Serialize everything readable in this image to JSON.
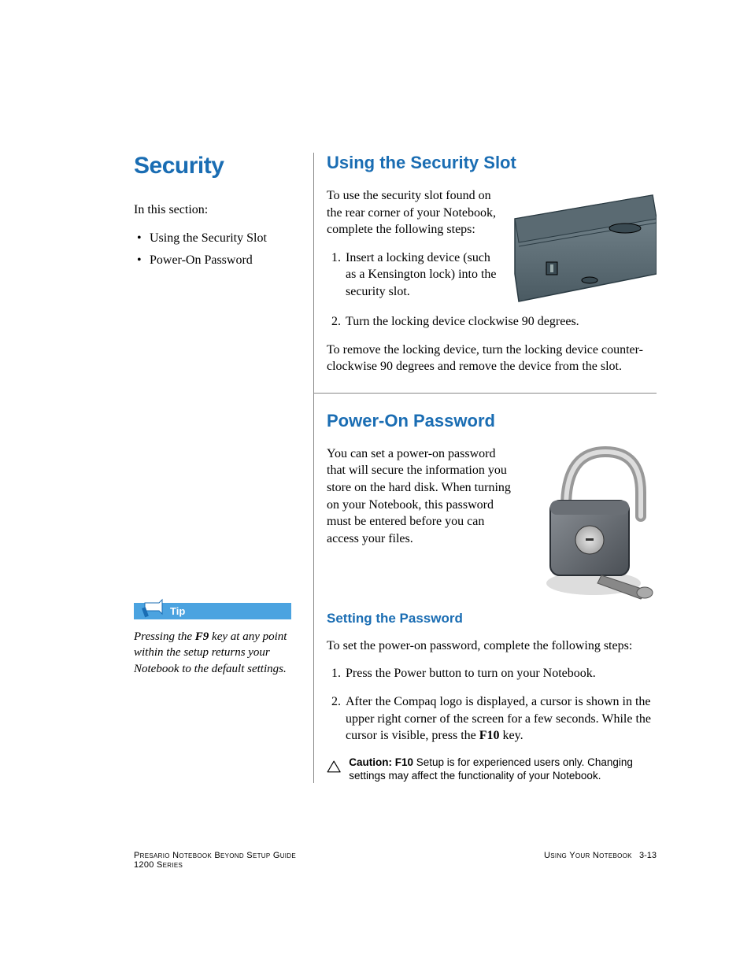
{
  "left": {
    "title": "Security",
    "intro": "In this section:",
    "toc": [
      "Using the Security Slot",
      "Power-On Password"
    ]
  },
  "tip": {
    "label": "Tip",
    "body_pre": "Pressing the ",
    "key": "F9",
    "body_post": " key at any point within the setup returns your Notebook to the default settings."
  },
  "sec1": {
    "heading": "Using the Security Slot",
    "p1": "To use the security slot found on the rear corner of your Notebook, complete the following steps:",
    "steps": [
      "Insert a locking device (such as a Kensington lock) into the security slot.",
      "Turn the locking device clockwise 90 degrees."
    ],
    "p2": "To remove the locking device, turn the locking device counter-clockwise 90 degrees and remove the device from the slot."
  },
  "sec2": {
    "heading": "Power-On Password",
    "p1": "You can set a power-on password that will secure the information you store on the hard disk. When turning on your Notebook, this password must be entered before you can access your files.",
    "sub": "Setting the Password",
    "p2": "To set the power-on password, complete the following steps:",
    "steps": {
      "s1": "Press the Power button to turn on your Notebook.",
      "s2_pre": "After the Compaq logo is displayed, a cursor is shown in the upper right corner of the screen for a few seconds. While the cursor is visible, press the ",
      "s2_key": "F10",
      "s2_post": " key."
    },
    "caution_label": "Caution: F10",
    "caution_text": " Setup is for experienced users only. Changing settings may affect the functionality of your Notebook."
  },
  "footer": {
    "left_line1": "Presario Notebook Beyond Setup Guide",
    "left_line2": "1200 Series",
    "right_section": "Using Your Notebook",
    "right_page": "3-13"
  }
}
